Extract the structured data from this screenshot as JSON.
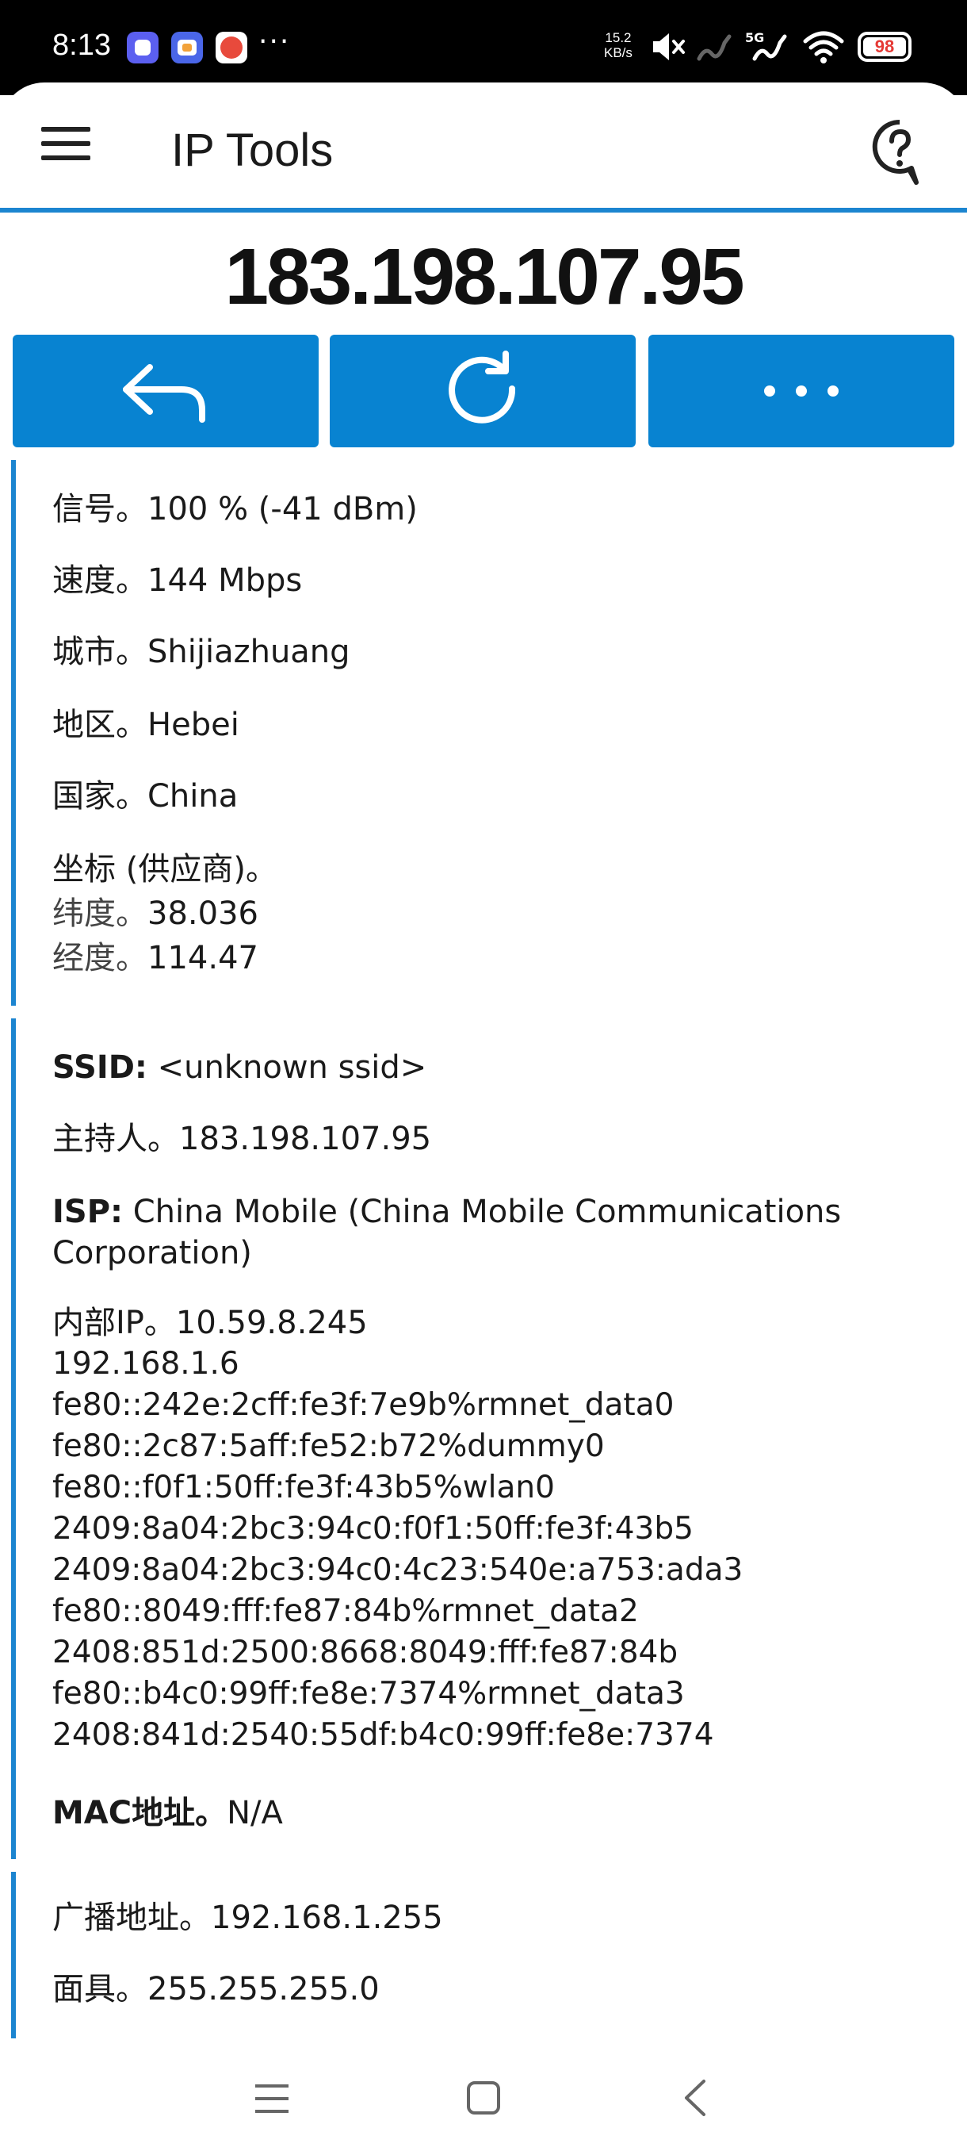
{
  "status_bar": {
    "time": "8:13",
    "more": "···",
    "speed_value": "15.2",
    "speed_unit": "KB/s",
    "network": "5G",
    "battery": "98"
  },
  "appbar": {
    "title": "IP Tools",
    "menu_icon": "menu-icon",
    "help_icon": "help-icon"
  },
  "ip_address": "183.198.107.95",
  "actions": {
    "back_icon": "back-arrow-icon",
    "refresh_icon": "refresh-icon",
    "more_icon": "more-horizontal-icon"
  },
  "section1": {
    "signal": {
      "label": "信号。",
      "value": "100 % (-41 dBm)"
    },
    "speed": {
      "label": "速度。",
      "value": "144 Mbps"
    },
    "city": {
      "label": "城市。",
      "value": "Shijiazhuang"
    },
    "region": {
      "label": "地区。",
      "value": "Hebei"
    },
    "country": {
      "label": "国家。",
      "value": "China"
    },
    "coords": {
      "label": "坐标 (供应商)。",
      "lat_label": "纬度。",
      "lat_value": "38.036",
      "lon_label": "经度。",
      "lon_value": "114.47"
    }
  },
  "section2": {
    "ssid": {
      "label": "SSID:",
      "value": " <unknown ssid>"
    },
    "host": {
      "label": "主持人。",
      "value": "183.198.107.95"
    },
    "isp": {
      "label": "ISP:",
      "value": " China Mobile (China Mobile Communications",
      "value2": "Corporation)"
    },
    "internal_ip": {
      "label": "内部IP。",
      "values": [
        "10.59.8.245",
        "192.168.1.6",
        "fe80::242e:2cff:fe3f:7e9b%rmnet_data0",
        "fe80::2c87:5aff:fe52:b72%dummy0",
        "fe80::f0f1:50ff:fe3f:43b5%wlan0",
        "2409:8a04:2bc3:94c0:f0f1:50ff:fe3f:43b5",
        "2409:8a04:2bc3:94c0:4c23:540e:a753:ada3",
        "fe80::8049:fff:fe87:84b%rmnet_data2",
        "2408:851d:2500:8668:8049:fff:fe87:84b",
        "fe80::b4c0:99ff:fe8e:7374%rmnet_data3",
        "2408:841d:2540:55df:b4c0:99ff:fe8e:7374"
      ]
    },
    "mac": {
      "label": "MAC地址。",
      "value": "N/A"
    }
  },
  "section3": {
    "broadcast": {
      "label": "广播地址。",
      "value": "192.168.1.255"
    },
    "mask": {
      "label": "面具。",
      "value": "255.255.255.0"
    }
  },
  "navbar": {
    "recents_icon": "recents-icon",
    "home_icon": "home-icon",
    "back_icon": "nav-back-icon"
  },
  "colors": {
    "accent": "#0883d1",
    "divider": "#1c85d0"
  }
}
